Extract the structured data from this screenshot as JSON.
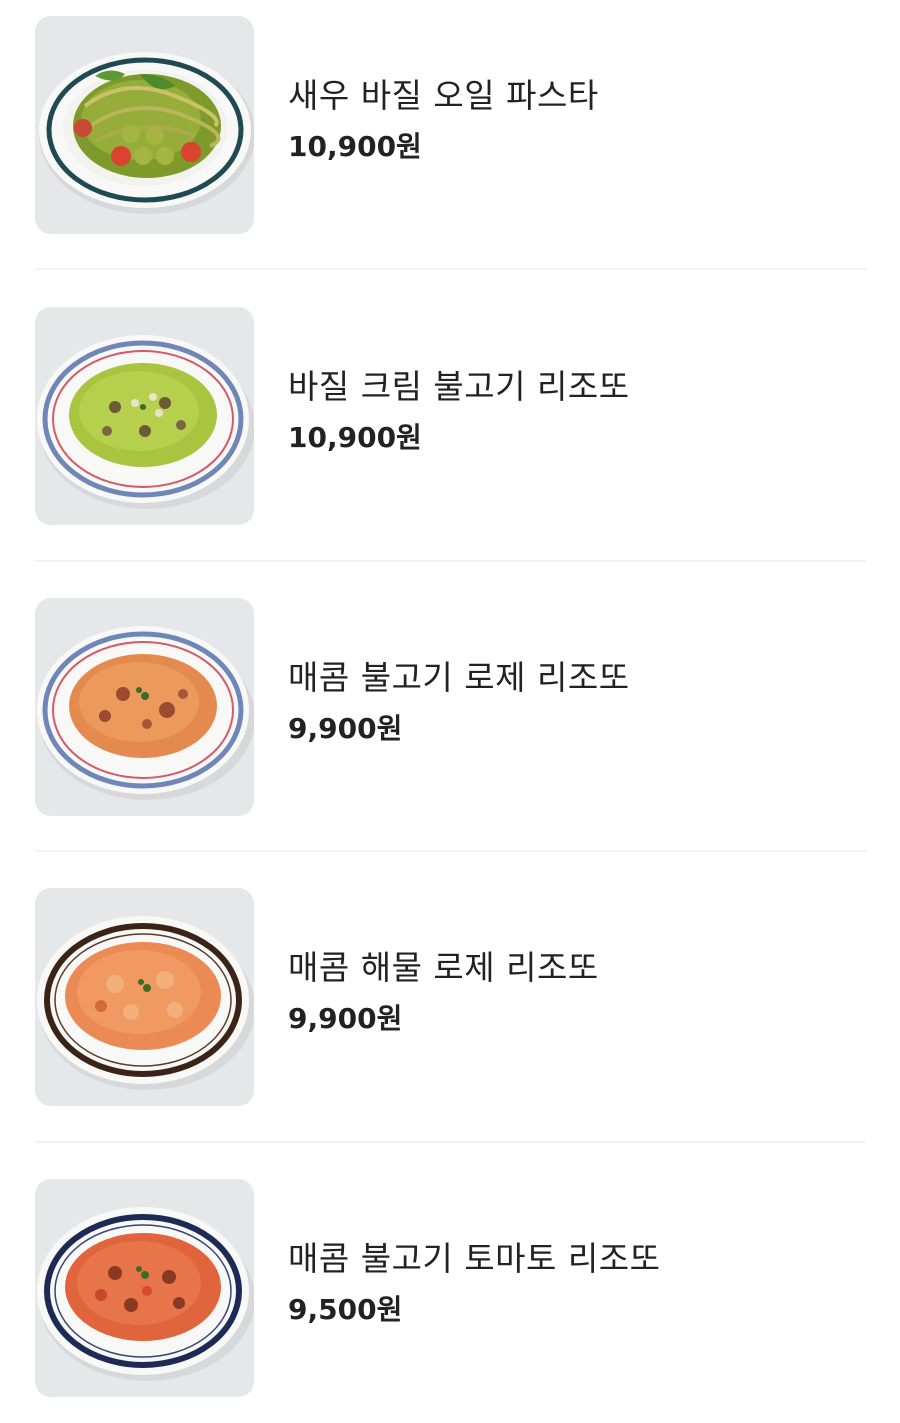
{
  "menu": {
    "items": [
      {
        "name": "새우 바질 오일 파스타",
        "price": "10,900원",
        "image": "shrimp-basil-oil-pasta-photo"
      },
      {
        "name": "바질 크림 불고기 리조또",
        "price": "10,900원",
        "image": "basil-cream-bulgogi-risotto-photo"
      },
      {
        "name": "매콤 불고기 로제 리조또",
        "price": "9,900원",
        "image": "spicy-bulgogi-rose-risotto-photo"
      },
      {
        "name": "매콤 해물 로제 리조또",
        "price": "9,900원",
        "image": "spicy-seafood-rose-risotto-photo"
      },
      {
        "name": "매콤 불고기 토마토 리조또",
        "price": "9,500원",
        "image": "spicy-bulgogi-tomato-risotto-photo"
      }
    ]
  }
}
